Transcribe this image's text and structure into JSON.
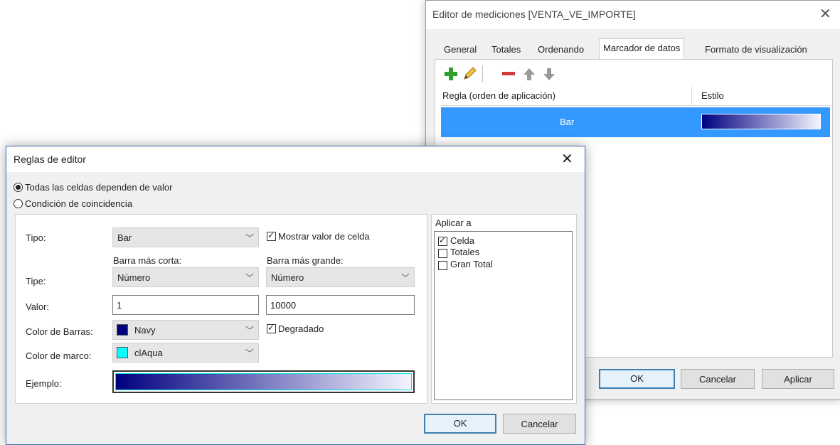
{
  "editor": {
    "title": "Editor de mediciones [VENTA_VE_IMPORTE]",
    "tabs": [
      "General",
      "Totales",
      "Ordenando",
      "Marcador de datos",
      "Formato de visualización"
    ],
    "active_tab": "Marcador de datos",
    "grid": {
      "columns": [
        "Regla (orden de aplicación)",
        "Estilo"
      ],
      "rows": [
        {
          "rule": "Bar",
          "style": "gradient navy to white"
        }
      ]
    },
    "buttons": {
      "ok": "OK",
      "cancel": "Cancelar",
      "apply": "Aplicar"
    }
  },
  "rules": {
    "title": "Reglas de editor",
    "radio_all": "Todas las celdas dependen de valor",
    "radio_match": "Condición de coincidencia",
    "tipo_label": "Tipo:",
    "tipo_value": "Bar",
    "show_value_label": "Mostrar valor de celda",
    "short_bar_label": "Barra más corta:",
    "long_bar_label": "Barra más grande:",
    "tipe_label": "Tipe:",
    "short_type": "Número",
    "long_type": "Número",
    "valor_label": "Valor:",
    "short_value": "1",
    "long_value": "10000",
    "bar_color_label": "Color de Barras:",
    "bar_color": "Navy",
    "gradient_label": "Degradado",
    "border_color_label": "Color de marco:",
    "border_color": "clAqua",
    "example_label": "Ejemplo:",
    "apply_to_title": "Aplicar a",
    "apply_to": [
      {
        "label": "Celda",
        "checked": true
      },
      {
        "label": "Totales",
        "checked": false
      },
      {
        "label": "Gran Total",
        "checked": false
      }
    ],
    "buttons": {
      "ok": "OK",
      "cancel": "Cancelar"
    }
  },
  "colors": {
    "selection": "#3399ff",
    "navy": "#000080",
    "aqua": "#00ffff"
  }
}
